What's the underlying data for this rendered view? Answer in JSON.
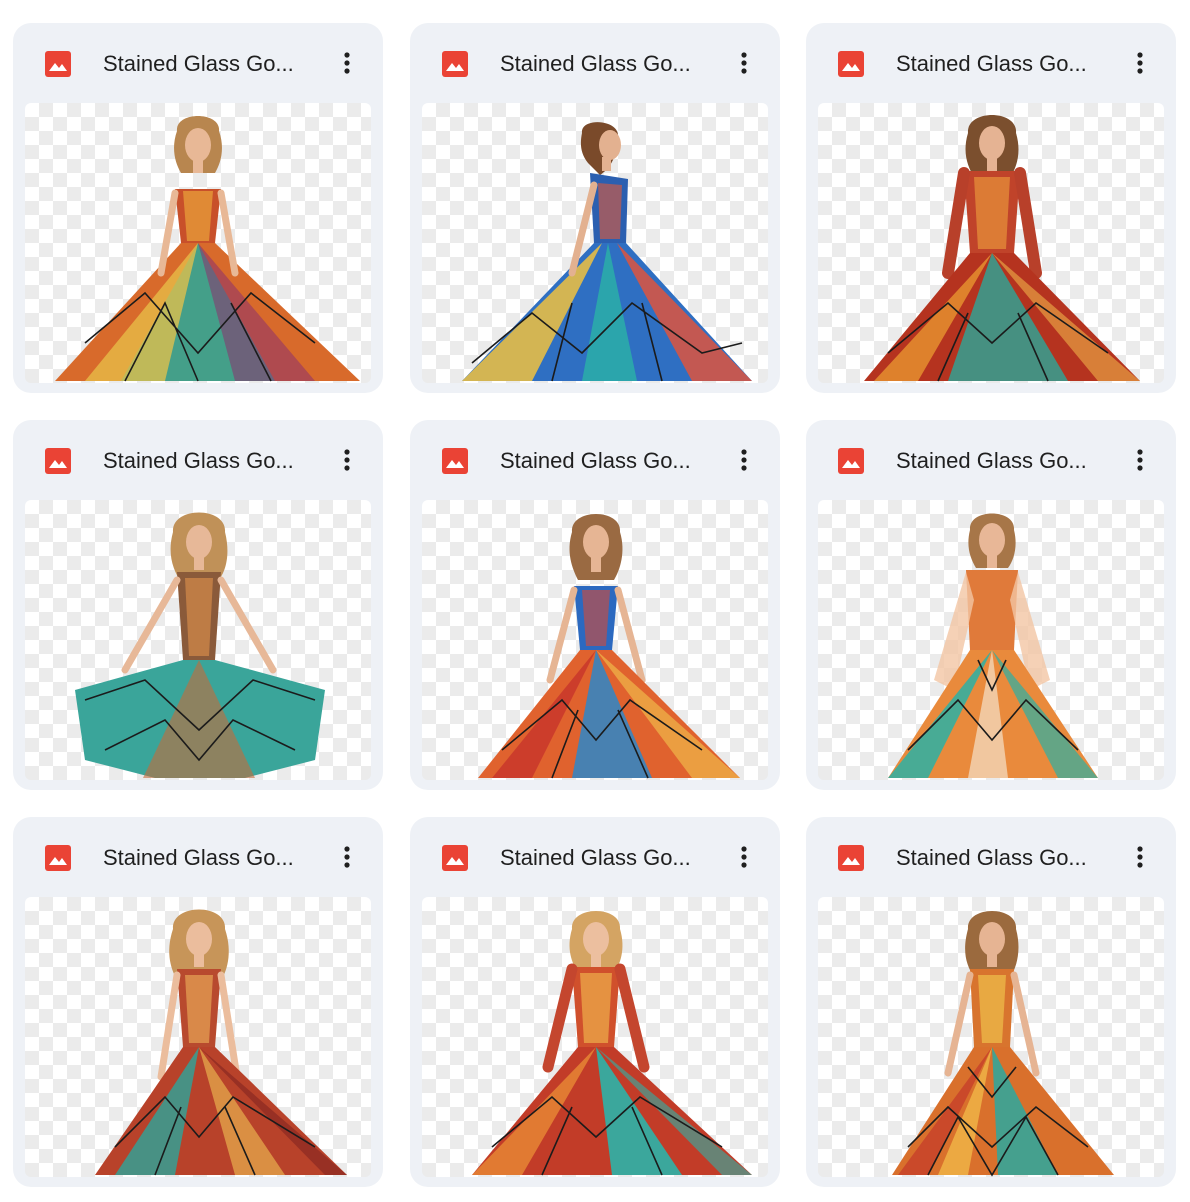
{
  "colors": {
    "card_bg": "#eef1f6",
    "icon_red": "#ea4335",
    "title_text": "#1f1f1f"
  },
  "files": [
    {
      "title": "Stained Glass Go...",
      "icon": "image-icon",
      "menu_icon": "more-vert-icon",
      "thumbnail": "girl in strapless stained glass ball gown, front view"
    },
    {
      "title": "Stained Glass Go...",
      "icon": "image-icon",
      "menu_icon": "more-vert-icon",
      "thumbnail": "girl in blue stained glass gown, side view"
    },
    {
      "title": "Stained Glass Go...",
      "icon": "image-icon",
      "menu_icon": "more-vert-icon",
      "thumbnail": "girl in long-sleeve red-orange stained glass gown"
    },
    {
      "title": "Stained Glass Go...",
      "icon": "image-icon",
      "menu_icon": "more-vert-icon",
      "thumbnail": "girl holding out teal stained glass skirt"
    },
    {
      "title": "Stained Glass Go...",
      "icon": "image-icon",
      "menu_icon": "more-vert-icon",
      "thumbnail": "girl in strapless orange and blue stained glass gown"
    },
    {
      "title": "Stained Glass Go...",
      "icon": "image-icon",
      "menu_icon": "more-vert-icon",
      "thumbnail": "girl in sheer-sleeve orange and teal stained glass gown"
    },
    {
      "title": "Stained Glass Go...",
      "icon": "image-icon",
      "menu_icon": "more-vert-icon",
      "thumbnail": "girl in red stained glass gown"
    },
    {
      "title": "Stained Glass Go...",
      "icon": "image-icon",
      "menu_icon": "more-vert-icon",
      "thumbnail": "girl in long-sleeve red and teal stained glass gown"
    },
    {
      "title": "Stained Glass Go...",
      "icon": "image-icon",
      "menu_icon": "more-vert-icon",
      "thumbnail": "girl in orange and teal mosaic stained glass gown"
    }
  ]
}
